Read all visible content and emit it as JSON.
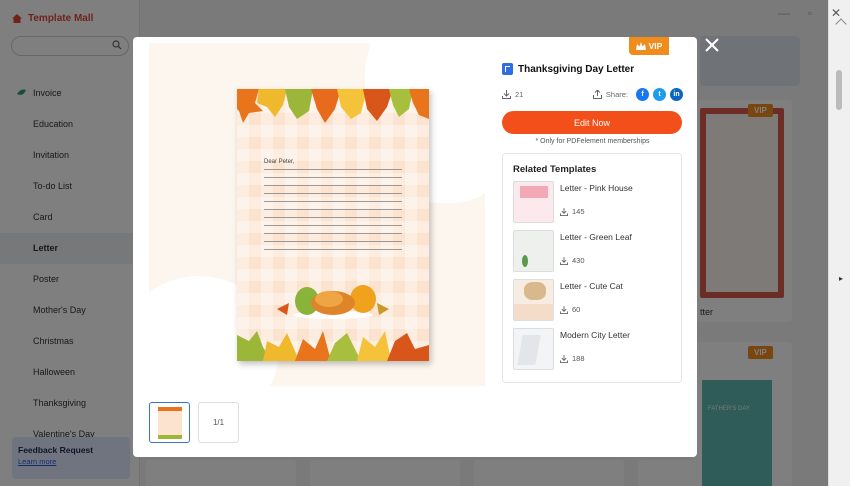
{
  "app": {
    "title": "Template Mall"
  },
  "search": {
    "placeholder": ""
  },
  "sidebar": {
    "items": [
      {
        "label": "Invoice"
      },
      {
        "label": "Education"
      },
      {
        "label": "Invitation"
      },
      {
        "label": "To-do List"
      },
      {
        "label": "Card"
      },
      {
        "label": "Letter",
        "active": true
      },
      {
        "label": "Poster"
      },
      {
        "label": "Mother's Day"
      },
      {
        "label": "Christmas"
      },
      {
        "label": "Halloween"
      },
      {
        "label": "Thanksgiving"
      },
      {
        "label": "Valentine's Day"
      }
    ],
    "feedback": {
      "title": "Feedback Request",
      "link": "Learn more"
    }
  },
  "background": {
    "vip_label": "VIP",
    "card_caption": "tter",
    "card_text": "FATHER'S DAY"
  },
  "modal": {
    "vip_label": "VIP",
    "template": {
      "title": "Thanksgiving Day Letter",
      "downloads": "21",
      "share_label": "Share:",
      "edit_label": "Edit Now",
      "member_note": "* Only for PDFelement memberships",
      "letter_greeting": "Dear Peter,"
    },
    "pages": {
      "indicator": "1/1"
    },
    "related": {
      "heading": "Related Templates",
      "items": [
        {
          "name": "Letter - Pink House",
          "downloads": "145"
        },
        {
          "name": "Letter - Green Leaf",
          "downloads": "430"
        },
        {
          "name": "Letter - Cute Cat",
          "downloads": "60"
        },
        {
          "name": "Modern City Letter",
          "downloads": "188"
        }
      ]
    }
  },
  "colors": {
    "accent": "#f24f1a",
    "vip": "#f08c1c",
    "brand": "#e0463a",
    "facebook": "#1877f2",
    "twitter": "#1d9bf0",
    "linkedin": "#0a66c2"
  }
}
